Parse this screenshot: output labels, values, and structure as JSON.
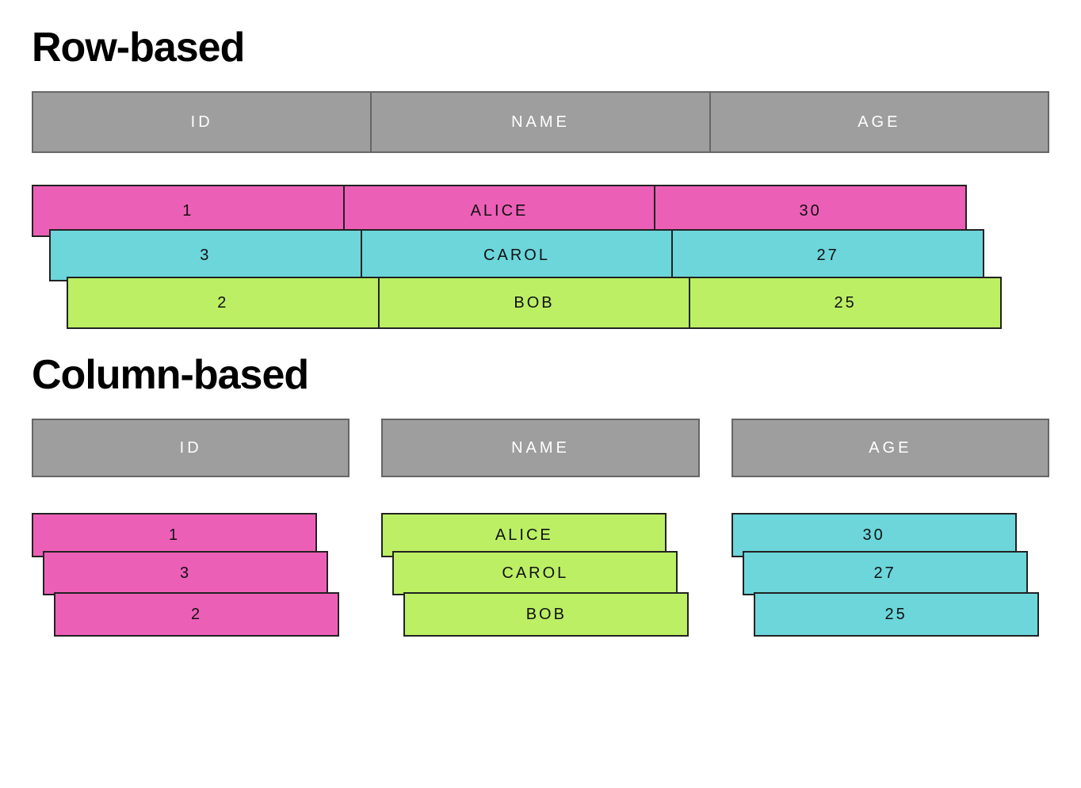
{
  "row_section_title": "Row-based",
  "col_section_title": "Column-based",
  "headers": {
    "id": "ID",
    "name": "NAME",
    "age": "AGE"
  },
  "row_based": {
    "rows": [
      {
        "color": "pink",
        "id": "1",
        "name": "ALICE",
        "age": "30"
      },
      {
        "color": "cyan",
        "id": "3",
        "name": "CAROL",
        "age": "27"
      },
      {
        "color": "lime",
        "id": "2",
        "name": "BOB",
        "age": "25"
      }
    ]
  },
  "col_based": {
    "columns": {
      "id": {
        "color": "pink",
        "values": [
          "1",
          "3",
          "2"
        ]
      },
      "name": {
        "color": "lime",
        "values": [
          "ALICE",
          "CAROL",
          "BOB"
        ]
      },
      "age": {
        "color": "cyan",
        "values": [
          "30",
          "27",
          "25"
        ]
      }
    }
  },
  "chart_data": {
    "type": "table",
    "title": "Row-based vs Column-based storage illustration",
    "columns": [
      "ID",
      "NAME",
      "AGE"
    ],
    "rows": [
      {
        "ID": 1,
        "NAME": "ALICE",
        "AGE": 30
      },
      {
        "ID": 3,
        "NAME": "CAROL",
        "AGE": 27
      },
      {
        "ID": 2,
        "NAME": "BOB",
        "AGE": 25
      }
    ],
    "colors": {
      "pink": "#ec5fb7",
      "cyan": "#6cd6db",
      "lime": "#bcef63",
      "header": "#9e9e9e"
    }
  }
}
